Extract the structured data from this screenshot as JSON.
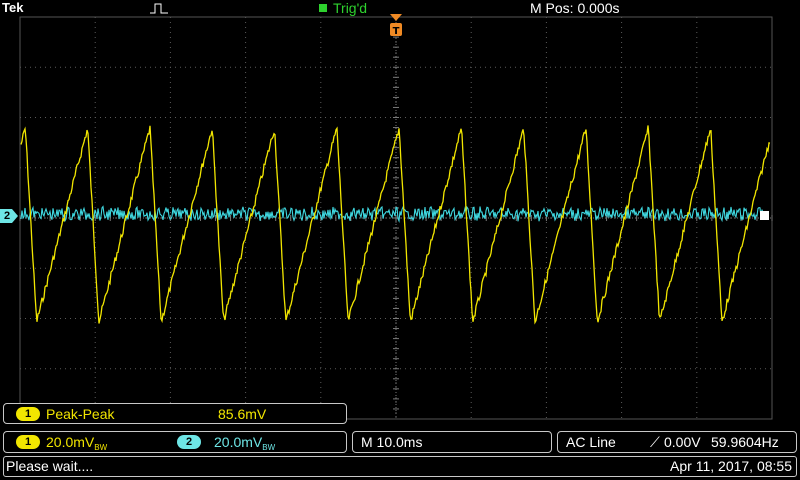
{
  "header": {
    "brand": "Tek",
    "trigger_status": "Trig'd",
    "horizontal_position": "M Pos: 0.000s"
  },
  "colors": {
    "ch1": "#f2e600",
    "ch2": "#6ee6e6",
    "trigger": "#2ed12e",
    "trigger_marker": "#f08a24",
    "grid": "#5a5a5a"
  },
  "markers": {
    "ch2_ground": "2"
  },
  "measurement": {
    "channel": "1",
    "name": "Peak-Peak",
    "value": "85.6mV"
  },
  "channels": [
    {
      "number": "1",
      "scale": "20.0mV",
      "bandwidth": "BW"
    },
    {
      "number": "2",
      "scale": "20.0mV",
      "bandwidth": "BW"
    }
  ],
  "timebase": "M 10.0ms",
  "trigger": {
    "source": "AC Line",
    "slope": "⟋",
    "level": "0.00V",
    "frequency": "59.9604Hz"
  },
  "status": {
    "message": "Please wait....",
    "datetime": "Apr 11, 2017, 08:55"
  }
}
